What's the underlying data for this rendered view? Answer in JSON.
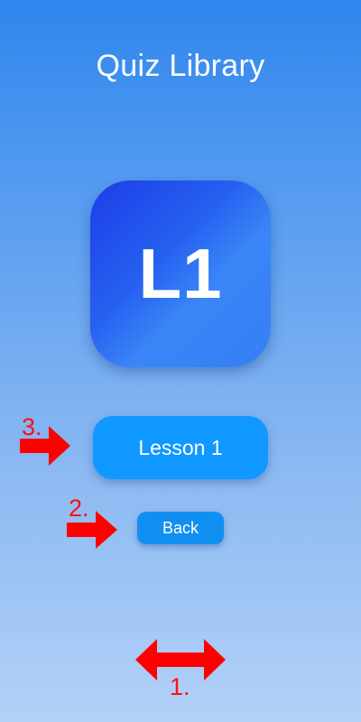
{
  "header": {
    "title": "Quiz Library"
  },
  "lesson_tile": {
    "label": "L1"
  },
  "buttons": {
    "lesson_label": "Lesson 1",
    "back_label": "Back"
  },
  "annotations": [
    {
      "label": "3.",
      "icon": "right-arrow-icon",
      "color": "#ff0000"
    },
    {
      "label": "2.",
      "icon": "right-arrow-icon",
      "color": "#ff0000"
    },
    {
      "label": "1.",
      "icon": "horizontal-double-arrow-icon",
      "color": "#ff0000"
    }
  ],
  "colors": {
    "background_top": "#2f86ee",
    "background_bottom": "#b3d1f7",
    "tile_gradient_start": "#1c3de8",
    "tile_gradient_end": "#3480f4",
    "lesson_button": "#0f98ff",
    "back_button": "#118ff0"
  }
}
